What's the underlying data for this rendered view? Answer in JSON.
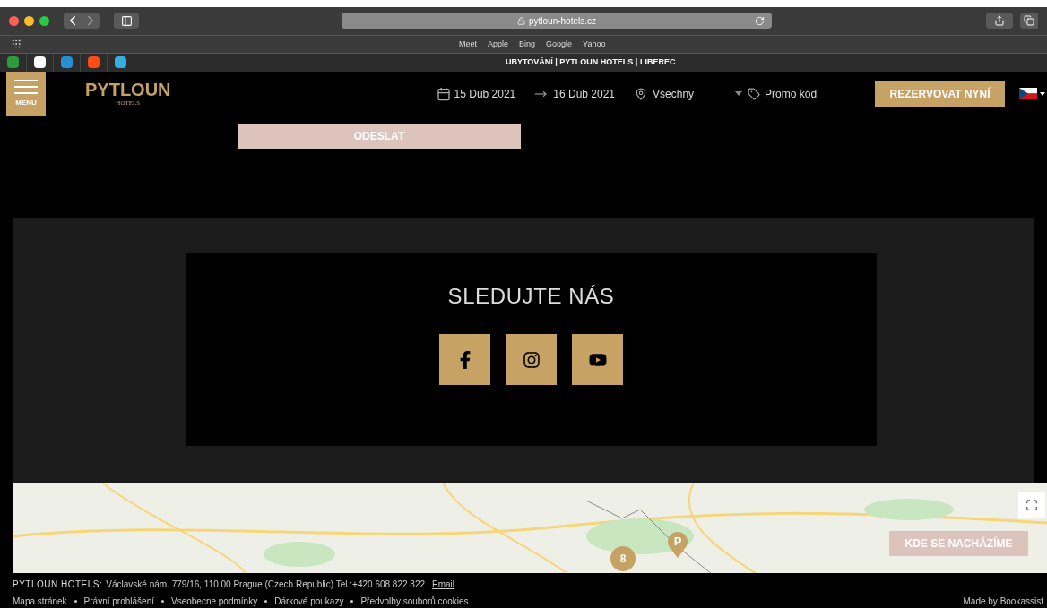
{
  "browser": {
    "url": "pytloun-hotels.cz",
    "favorites": [
      "Meet",
      "Apple",
      "Bing",
      "Google",
      "Yahoo"
    ],
    "tab_title": "UBYTOVÁNÍ | PYTLOUN HOTELS | LIBEREC"
  },
  "header": {
    "menu_label": "MENU",
    "logo": "PYTLOUN",
    "logo_sub": "HOTELS",
    "date_from": "15 Dub 2021",
    "date_to": "16 Dub 2021",
    "location": "Všechny",
    "promo": "Promo kód",
    "book_button": "REZERVOVAT NYNÍ"
  },
  "form": {
    "submit_button": "ODESLAT"
  },
  "social": {
    "title": "SLEDUJTE NÁS",
    "links": [
      {
        "kind": "facebook"
      },
      {
        "kind": "instagram"
      },
      {
        "kind": "youtube"
      }
    ]
  },
  "map": {
    "cluster_count": "8",
    "pin_label": "P",
    "locate_button": "KDE SE NACHÁZÍME"
  },
  "footer": {
    "brand": "PYTLOUN HOTELS:",
    "address": "Václavské nám. 779/16, 110 00 Prague (Czech Republic) Tel.:+420 608 822 822",
    "email_link": "Email",
    "links": [
      "Mapa stránek",
      "Právní prohlášení",
      "Vseobecne podmínky",
      "Dárkové poukazy",
      "Předvolby souborů cookies"
    ],
    "credit": "Made by Bookassist"
  }
}
